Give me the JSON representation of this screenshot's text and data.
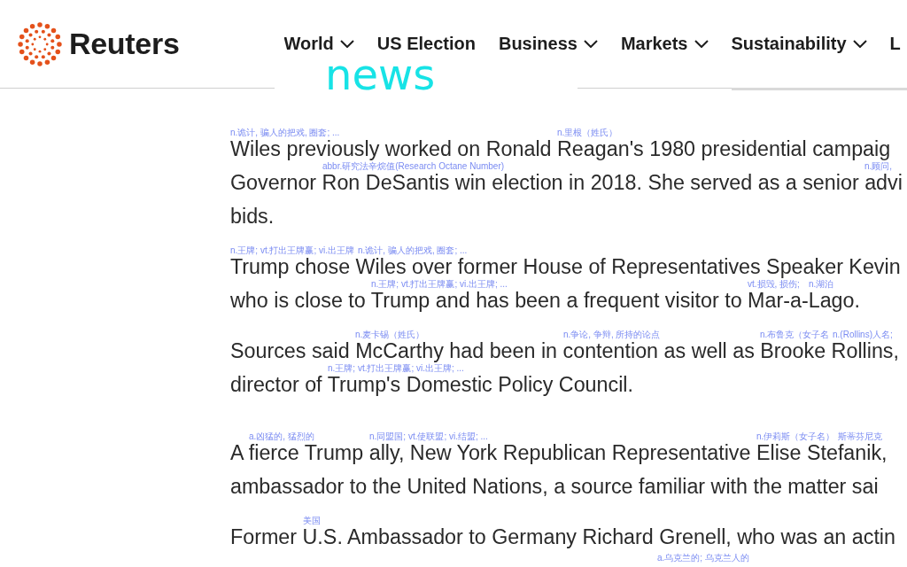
{
  "header": {
    "logo": {
      "wordmark": "Reuters"
    },
    "nav": [
      {
        "label": "World",
        "dropdown": true
      },
      {
        "label": "US Election",
        "dropdown": false
      },
      {
        "label": "Business",
        "dropdown": true
      },
      {
        "label": "Markets",
        "dropdown": true
      },
      {
        "label": "Sustainability",
        "dropdown": true
      },
      {
        "label": "L",
        "dropdown": false
      }
    ]
  },
  "popup": {
    "word": "news"
  },
  "article": {
    "paragraphs": [
      {
        "lines": [
          {
            "kind": "text",
            "segments": [
              {
                "text": "Wiles",
                "gloss": "n.诡计, 骗人的把戏, 圈套; ..."
              },
              {
                "text": " previously worked on Ronald "
              },
              {
                "text": "Reagan's",
                "gloss": "n.里根（姓氏）"
              },
              {
                "text": " 1980 presidential campaig"
              }
            ]
          },
          {
            "kind": "text",
            "segments": [
              {
                "text": "Governor "
              },
              {
                "text": "Ron",
                "gloss": "abbr.研究法辛烷值(Research Octane Number)"
              },
              {
                "text": " DeSantis win election in 2018. She served as a senior "
              },
              {
                "text": "advi",
                "gloss": "n.顾问,"
              }
            ]
          },
          {
            "kind": "text",
            "segments": [
              {
                "text": "bids."
              }
            ]
          }
        ]
      },
      {
        "lines": [
          {
            "kind": "text",
            "segments": [
              {
                "text": "Trump",
                "gloss": "n.王牌; vt.打出王牌赢; vi.出王牌"
              },
              {
                "text": " chose "
              },
              {
                "text": "Wiles",
                "gloss": "n.诡计, 骗人的把戏, 圈套; ..."
              },
              {
                "text": " over former House of Representatives Speaker Kevin"
              }
            ]
          },
          {
            "kind": "text",
            "segments": [
              {
                "text": "who is close to "
              },
              {
                "text": "Trump",
                "gloss": "n.王牌; vt.打出王牌赢; vi.出王牌; ..."
              },
              {
                "text": " and has been a frequent visitor to "
              },
              {
                "text": "Mar",
                "gloss": "vt.损毁, 损伤;"
              },
              {
                "text": "-a-"
              },
              {
                "text": "Lago",
                "gloss": "n.湖泊"
              },
              {
                "text": "."
              }
            ]
          }
        ]
      },
      {
        "lines": [
          {
            "kind": "text",
            "segments": [
              {
                "text": "Sources said "
              },
              {
                "text": "McCarthy",
                "gloss": "n.麦卡锡（姓氏）"
              },
              {
                "text": " had been in "
              },
              {
                "text": "contention",
                "gloss": "n.争论, 争辩, 所持的论点"
              },
              {
                "text": " as well as "
              },
              {
                "text": "Brooke ",
                "gloss": "n.布鲁克（女子名"
              },
              {
                "text": "Rollins",
                "gloss": "n.(Rollins)人名;"
              },
              {
                "text": ","
              }
            ]
          },
          {
            "kind": "text",
            "segments": [
              {
                "text": "director of "
              },
              {
                "text": "Trump's",
                "gloss": "n.王牌; vt.打出王牌赢; vi.出王牌; ..."
              },
              {
                "text": " Domestic Policy Council."
              }
            ]
          }
        ]
      },
      {
        "lines": [
          {
            "kind": "text",
            "segments": [
              {
                "text": "A "
              },
              {
                "text": "fierce",
                "gloss": "a.凶猛的, 猛烈的"
              },
              {
                "text": " Trump "
              },
              {
                "text": "ally",
                "gloss": "n.同盟国; vt.使联盟; vi.结盟; ..."
              },
              {
                "text": ", New York Republican Representative "
              },
              {
                "text": "Elise ",
                "gloss": "n.伊莉斯（女子名）"
              },
              {
                "text": "Stefanik",
                "gloss": "斯蒂芬尼克"
              },
              {
                "text": ","
              }
            ]
          },
          {
            "kind": "text",
            "segments": [
              {
                "text": "ambassador to the United Nations, a source familiar with the matter sai"
              }
            ]
          }
        ]
      },
      {
        "lines": [
          {
            "kind": "text",
            "segments": [
              {
                "text": "Former "
              },
              {
                "text": "U.S.",
                "gloss": "美国"
              },
              {
                "text": " Ambassador to Germany Richard Grenell, who was an actin"
              }
            ]
          },
          {
            "kind": "glosses_only",
            "segments": [
              {
                "gloss": "a.乌克兰的; 乌克兰人的"
              }
            ]
          }
        ]
      }
    ]
  }
}
